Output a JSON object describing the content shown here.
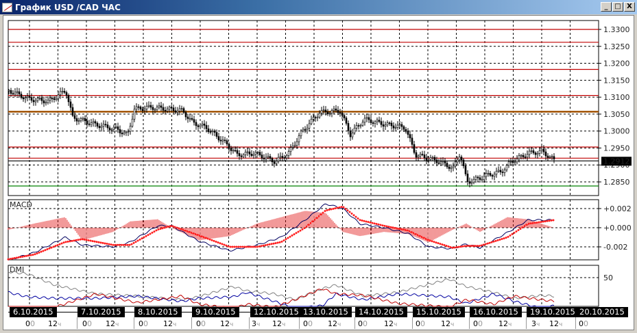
{
  "window": {
    "title": "График USD /CAD  ЧАС",
    "buttons": {
      "minimize": "_",
      "maximize": "□",
      "close": "X"
    }
  },
  "colors": {
    "up": "#000000",
    "level_red": "#c00000",
    "level_brown": "#a05000",
    "level_green": "#008000",
    "macd": "#000060",
    "signal": "#ff2020",
    "hist": "#e00000",
    "adx": "#808080",
    "plus_di": "#0000a0",
    "minus_di": "#c00000"
  },
  "chart_data": [
    {
      "type": "line",
      "title": "USD/CAD hourly price",
      "pane": "main",
      "y_ticks": [
        "1.3300",
        "1.3250",
        "1.3200",
        "1.3150",
        "1.3100",
        "1.3050",
        "1.3000",
        "1.2950",
        "1.2900",
        "1.2850"
      ],
      "ylim": [
        1.282,
        1.333
      ],
      "current_price": "1.2912",
      "levels": [
        {
          "v": 1.33,
          "c": "red"
        },
        {
          "v": 1.3262,
          "c": "red"
        },
        {
          "v": 1.3182,
          "c": "red"
        },
        {
          "v": 1.3105,
          "c": "red"
        },
        {
          "v": 1.3057,
          "c": "brown"
        },
        {
          "v": 1.2953,
          "c": "red"
        },
        {
          "v": 1.292,
          "c": "red"
        },
        {
          "v": 1.2912,
          "c": "black"
        },
        {
          "v": 1.2838,
          "c": "green"
        }
      ],
      "x": [
        0,
        28,
        58,
        83,
        93,
        125,
        158,
        173,
        183,
        208,
        253,
        268,
        288,
        318,
        333,
        358,
        388,
        408,
        428,
        453,
        483,
        498,
        518,
        548,
        578,
        593,
        628,
        648,
        658,
        668,
        678,
        698,
        718,
        733,
        758,
        778,
        796
      ],
      "close": [
        1.312,
        1.3095,
        1.3088,
        1.312,
        1.304,
        1.302,
        1.3005,
        1.2988,
        1.3065,
        1.307,
        1.306,
        1.3025,
        1.301,
        1.296,
        1.293,
        1.2935,
        1.291,
        1.2935,
        1.3,
        1.3055,
        1.306,
        1.299,
        1.3035,
        1.302,
        1.301,
        1.293,
        1.291,
        1.289,
        1.2935,
        1.285,
        1.2855,
        1.287,
        1.288,
        1.291,
        1.2935,
        1.294,
        1.2912
      ]
    },
    {
      "type": "line",
      "title": "MACD",
      "pane": "macd",
      "y_ticks": [
        "+0.002",
        "+0.000",
        "-0.002"
      ],
      "ylim": [
        -0.0035,
        0.003
      ],
      "x": [
        0,
        38,
        83,
        108,
        153,
        178,
        218,
        238,
        278,
        323,
        363,
        398,
        433,
        463,
        488,
        513,
        548,
        583,
        613,
        648,
        668,
        688,
        728,
        758,
        796
      ],
      "macd": [
        -0.0034,
        -0.0026,
        -0.001,
        -0.0018,
        -0.002,
        -0.0015,
        0.0002,
        0.0002,
        -0.0014,
        -0.0024,
        -0.0018,
        -0.001,
        0.0008,
        0.0025,
        0.002,
        0.0004,
        0.0,
        -0.0006,
        -0.002,
        -0.0022,
        -0.0017,
        -0.0021,
        -0.0005,
        0.0008,
        0.0008
      ],
      "signal": [
        -0.0033,
        -0.0028,
        -0.0015,
        -0.0012,
        -0.0018,
        -0.0018,
        -0.0002,
        0.0002,
        -0.0008,
        -0.002,
        -0.002,
        -0.0015,
        0.0,
        0.0018,
        0.0022,
        0.0008,
        0.0002,
        -0.0003,
        -0.0013,
        -0.0021,
        -0.0019,
        -0.0019,
        -0.001,
        0.0004,
        0.0008
      ]
    },
    {
      "type": "line",
      "title": "DMI",
      "pane": "dmi",
      "y_ticks": [
        "50"
      ],
      "ylim": [
        0,
        60
      ],
      "x": [
        0,
        28,
        68,
        128,
        188,
        253,
        278,
        328,
        348,
        388,
        418,
        458,
        478,
        518,
        568,
        643,
        668,
        708,
        738,
        778,
        796
      ],
      "adx": [
        58,
        55,
        40,
        28,
        25,
        20,
        24,
        38,
        32,
        28,
        20,
        35,
        40,
        25,
        30,
        48,
        38,
        30,
        22,
        26,
        25
      ],
      "plus_di": [
        30,
        24,
        22,
        22,
        25,
        18,
        22,
        24,
        30,
        18,
        8,
        12,
        28,
        20,
        28,
        24,
        15,
        28,
        18,
        8,
        12
      ],
      "minus_di": [
        0,
        2,
        10,
        28,
        16,
        25,
        14,
        8,
        14,
        10,
        20,
        35,
        28,
        26,
        15,
        10,
        20,
        14,
        25,
        20,
        18
      ]
    }
  ],
  "time_axis": {
    "dates": [
      "6.10.2015",
      "7.10.2015",
      "8.10.2015",
      "9.10.2015",
      "12.10.2015",
      "13.10.2015",
      "14.10.2015",
      "15.10.2015",
      "16.10.2015",
      "19.10.2015",
      "20.10.2015"
    ],
    "hours": [
      [
        "0",
        "0"
      ],
      [
        "12",
        "ч"
      ],
      [
        "0",
        "0"
      ],
      [
        "12",
        "ч"
      ],
      [
        "0",
        "0"
      ],
      [
        "12",
        "ч"
      ],
      [
        "0",
        "0"
      ],
      [
        "12",
        "ч"
      ],
      [
        "3",
        "ч"
      ],
      [
        "12",
        "ч"
      ],
      [
        "0",
        "0"
      ],
      [
        "12",
        "ч"
      ],
      [
        "0",
        "0"
      ],
      [
        "12",
        "ч"
      ],
      [
        "0",
        "0"
      ],
      [
        "12",
        "ч"
      ],
      [
        "0",
        "0"
      ],
      [
        "12",
        "ч"
      ],
      [
        "3",
        "ч"
      ],
      [
        "12",
        "ч"
      ],
      [
        "0",
        "0"
      ]
    ]
  }
}
